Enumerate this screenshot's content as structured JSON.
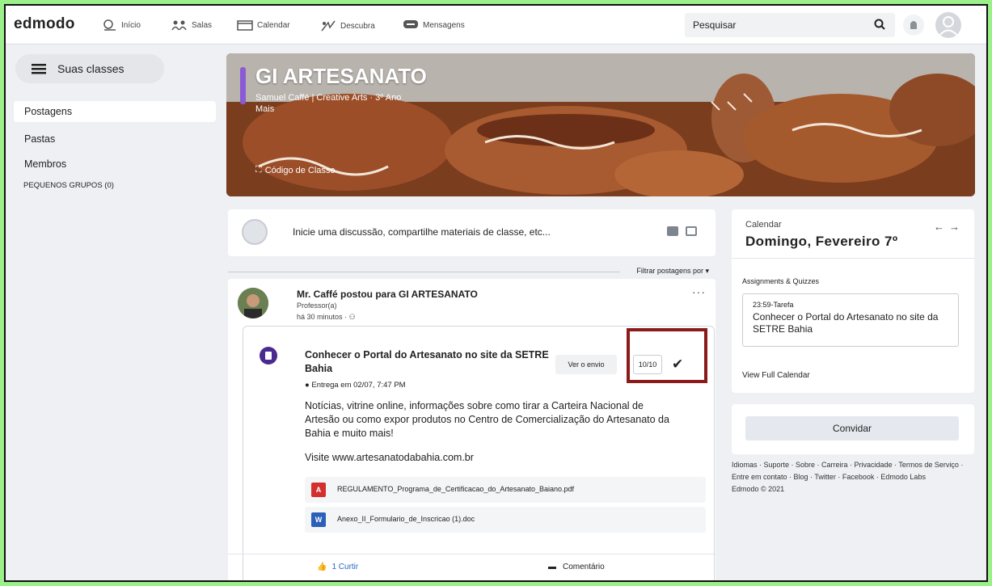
{
  "logo": "edmodo",
  "nav": [
    {
      "label": "Início",
      "icon": "home-icon"
    },
    {
      "label": "Salas",
      "icon": "groups-icon"
    },
    {
      "label": "Calendar",
      "icon": "calendar-icon"
    },
    {
      "label": "Descubra",
      "icon": "discover-icon"
    },
    {
      "label": "Mensagens",
      "icon": "messages-icon"
    }
  ],
  "search": {
    "placeholder": "Pesquisar"
  },
  "sidebar": {
    "classes_button": "Suas classes",
    "items": [
      {
        "label": "Postagens"
      },
      {
        "label": "Pastas"
      },
      {
        "label": "Membros"
      }
    ],
    "small_groups": "PEQUENOS GRUPOS (0)"
  },
  "banner": {
    "title": "GI ARTESANATO",
    "subtitle": "Samuel Caffé | Creative Arts · 3º Ano",
    "more": "Mais",
    "class_code": "Código de Classe",
    "accent": "#8b5bd6"
  },
  "composer": {
    "prompt": "Inicie uma discussão, compartilhe materiais de classe, etc..."
  },
  "filter_label": "Filtrar postagens por",
  "post": {
    "author": "Mr. Caffé postou para GI ARTESANATO",
    "role": "Professor(a)",
    "time": "há 30 minutos ·",
    "assignment": {
      "title": "Conhecer o Portal do Artesanato no site da SETRE Bahia",
      "due": "Entrega em 02/07, 7:47 PM",
      "view_button": "Ver o envio",
      "score": "10/10",
      "description": "Notícias, vitrine online, informações sobre como tirar a Carteira Nacional de Artesão ou como expor produtos no Centro de Comercialização do Artesanato da Bahia e muito mais!",
      "visit": "Visite www.artesanatodabahia.com.br",
      "files": [
        {
          "name": "REGULAMENTO_Programa_de_Certificacao_do_Artesanato_Baiano.pdf",
          "icon": "pdf-icon",
          "color": "#d32f2f",
          "badge": "A"
        },
        {
          "name": "Anexo_II_Formulario_de_Inscricao (1).doc",
          "icon": "word-icon",
          "color": "#2b5fb8",
          "badge": "W"
        }
      ]
    },
    "like_label": "1 Curtir",
    "comment_label": "Comentário"
  },
  "calendar": {
    "label": "Calendar",
    "date": "Domingo, Fevereiro 7º",
    "section": "Assignments & Quizzes",
    "item_time": "23:59-Tarefa",
    "item_title": "Conhecer o Portal do Artesanato no site da SETRE Bahia",
    "view_link": "View Full Calendar"
  },
  "invite_label": "Convidar",
  "footer": {
    "links": "Idiomas · Suporte · Sobre · Carreira · Privacidade · Termos de Serviço · Entre em contato · Blog · Twitter · Facebook · Edmodo Labs",
    "copyright": "Edmodo © 2021"
  },
  "colors": {
    "highlight": "#8b1a1a",
    "assignment_icon": "#4b2a8f",
    "like": "#2a66c8",
    "outer_frame": "#9bf08a"
  }
}
